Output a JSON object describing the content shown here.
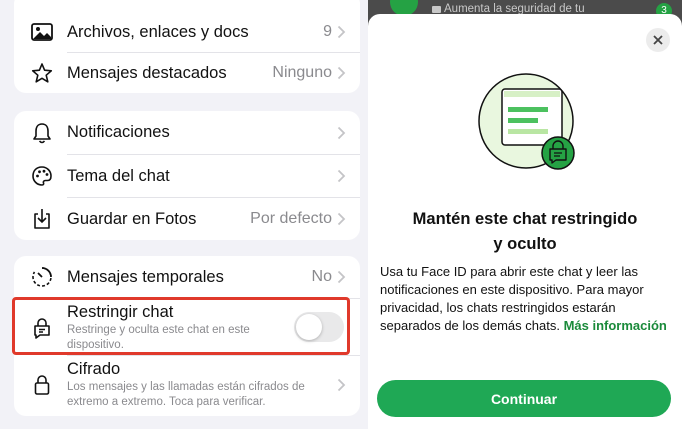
{
  "left_panel": {
    "files_row": {
      "label": "Archivos, enlaces y docs",
      "value": "9",
      "icon": "photo-icon"
    },
    "starred_row": {
      "label": "Mensajes destacados",
      "value": "Ninguno",
      "icon": "star-icon"
    },
    "notifications_row": {
      "label": "Notificaciones",
      "icon": "bell-icon"
    },
    "theme_row": {
      "label": "Tema del chat",
      "icon": "palette-icon"
    },
    "save_photos_row": {
      "label": "Guardar en Fotos",
      "value": "Por defecto",
      "icon": "download-icon"
    },
    "disappearing_row": {
      "label": "Mensajes temporales",
      "value": "No",
      "icon": "timer-icon"
    },
    "restrict_row": {
      "label": "Restringir chat",
      "subtitle": "Restringe y oculta este chat en este dispositivo.",
      "toggle_on": false,
      "icon": "locked-chat-icon"
    },
    "encryption_row": {
      "label": "Cifrado",
      "subtitle": "Los mensajes y las llamadas están cifrados de extremo a extremo. Toca para verificar.",
      "icon": "lock-icon"
    },
    "highlight_color": "#e0392b"
  },
  "background_chat": {
    "preview_text": "Aumenta la seguridad de tu",
    "badge": "3"
  },
  "sheet": {
    "title_line1": "Mantén este chat restringido",
    "title_line2": "y oculto",
    "body": "Usa tu Face ID para abrir este chat y leer las notificaciones en este dispositivo. Para mayor privacidad, los chats restringidos estarán separados de los demás chats.",
    "link": "Más información",
    "continue_label": "Continuar",
    "accent": "#1fa855"
  }
}
